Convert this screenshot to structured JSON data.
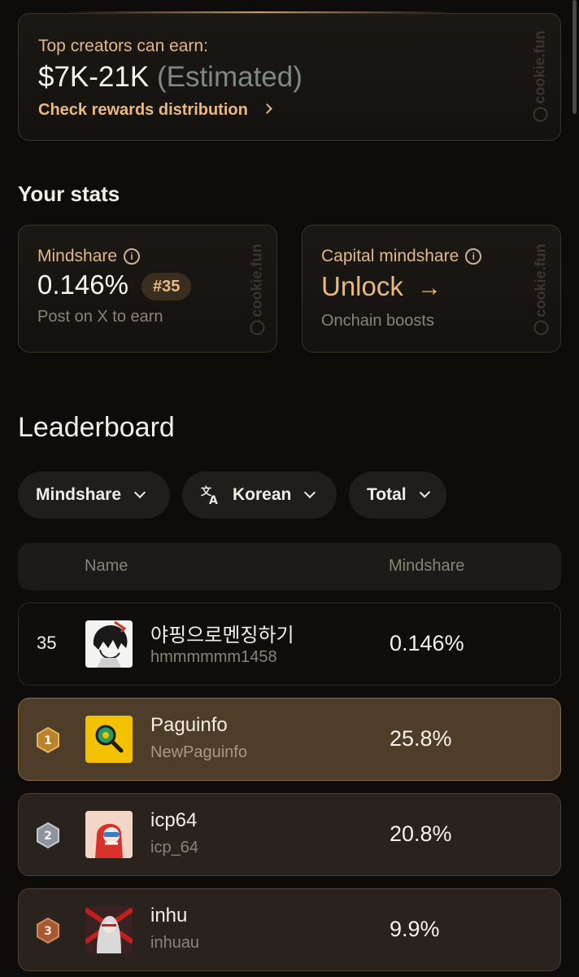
{
  "rewards": {
    "label": "Top creators can earn:",
    "amount": "$7K-21K",
    "estimated": "(Estimated)",
    "link": "Check rewards distribution",
    "watermark": "cookie.fun"
  },
  "stats": {
    "heading": "Your stats",
    "mindshare": {
      "label": "Mindshare",
      "value": "0.146%",
      "rank": "#35",
      "sub": "Post on X to earn"
    },
    "capital": {
      "label": "Capital mindshare",
      "value": "Unlock",
      "sub": "Onchain boosts"
    }
  },
  "leaderboard": {
    "heading": "Leaderboard",
    "filters": {
      "metric": "Mindshare",
      "language": "Korean",
      "period": "Total"
    },
    "columns": {
      "name": "Name",
      "mindshare": "Mindshare"
    },
    "rows": [
      {
        "rank": "35",
        "name": "야핑으로멘징하기",
        "handle": "hmmmmmm1458",
        "value": "0.146%"
      },
      {
        "rank": "1",
        "name": "Paguinfo",
        "handle": "NewPaguinfo",
        "value": "25.8%"
      },
      {
        "rank": "2",
        "name": "icp64",
        "handle": "icp_64",
        "value": "20.8%"
      },
      {
        "rank": "3",
        "name": "inhu",
        "handle": "inhuau",
        "value": "9.9%"
      }
    ]
  },
  "colors": {
    "accent": "#e9b984",
    "gold_row": "#4e3d28",
    "brown_row": "#2a231d",
    "background": "#0d0c0b"
  }
}
